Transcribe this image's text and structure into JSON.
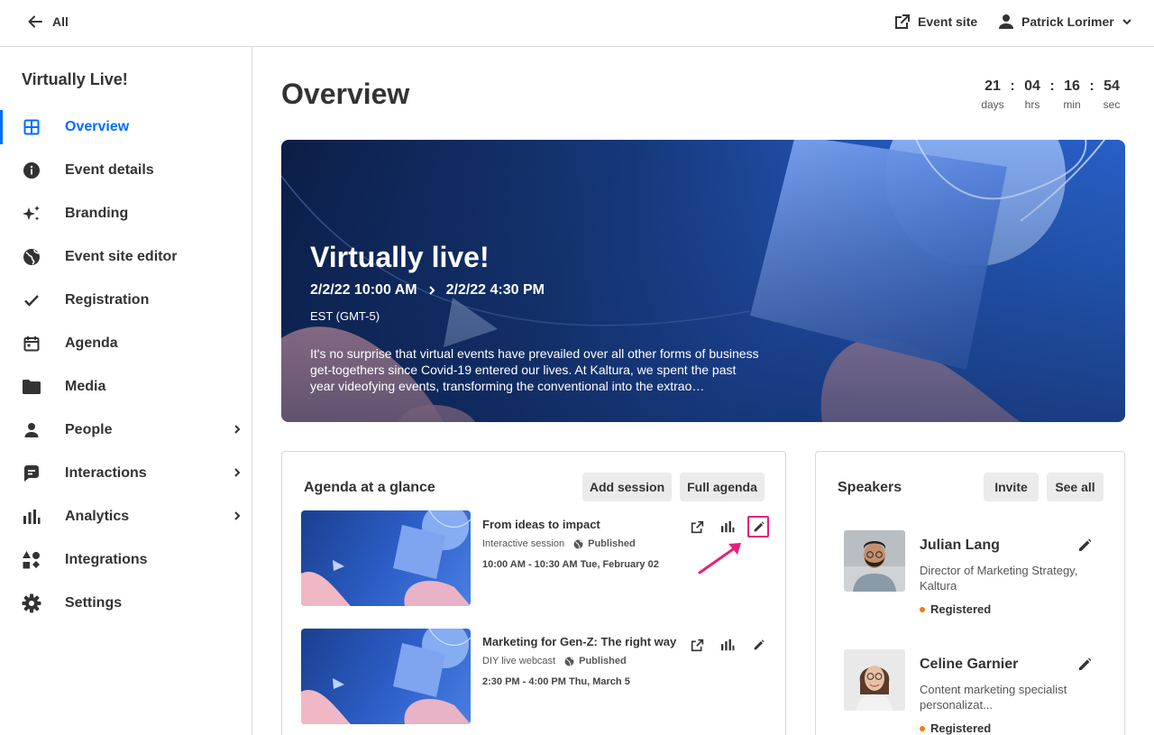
{
  "topbar": {
    "back_label": "All",
    "event_site_label": "Event site",
    "user_name": "Patrick Lorimer"
  },
  "sidebar": {
    "event_name": "Virtually Live!",
    "items": [
      {
        "label": "Overview",
        "icon": "grid-icon",
        "active": true
      },
      {
        "label": "Event details",
        "icon": "info-icon"
      },
      {
        "label": "Branding",
        "icon": "sparkle-icon"
      },
      {
        "label": "Event site editor",
        "icon": "globe-icon"
      },
      {
        "label": "Registration",
        "icon": "check-icon"
      },
      {
        "label": "Agenda",
        "icon": "calendar-icon"
      },
      {
        "label": "Media",
        "icon": "folder-icon"
      },
      {
        "label": "People",
        "icon": "person-icon",
        "expandable": true
      },
      {
        "label": "Interactions",
        "icon": "chat-icon",
        "expandable": true
      },
      {
        "label": "Analytics",
        "icon": "bar-chart-icon",
        "expandable": true
      },
      {
        "label": "Integrations",
        "icon": "shapes-icon"
      },
      {
        "label": "Settings",
        "icon": "gear-icon"
      }
    ]
  },
  "main": {
    "title": "Overview",
    "countdown": {
      "days": "21",
      "days_label": "days",
      "hrs": "04",
      "hrs_label": "hrs",
      "min": "16",
      "min_label": "min",
      "sec": "54",
      "sec_label": "sec",
      "separator": ":"
    },
    "hero": {
      "title": "Virtually live!",
      "start": "2/2/22 10:00 AM",
      "end": "2/2/22 4:30 PM",
      "timezone": "EST (GMT-5)",
      "description": "It's no surprise that virtual events have prevailed over all other forms of business get-togethers since Covid-19 entered our lives. At Kaltura, we spent the past year videofying events, transforming the conventional into the extrao…"
    },
    "agenda": {
      "title": "Agenda at a glance",
      "add_session_label": "Add session",
      "full_agenda_label": "Full agenda",
      "sessions": [
        {
          "title": "From ideas to impact",
          "type": "Interactive session",
          "status": "Published",
          "time": "10:00 AM - 10:30 AM  Tue, February 02"
        },
        {
          "title": "Marketing for Gen-Z: The right way",
          "type": "DIY live webcast",
          "status": "Published",
          "time": "2:30 PM - 4:00 PM Thu, March 5"
        }
      ]
    },
    "speakers": {
      "title": "Speakers",
      "invite_label": "Invite",
      "see_all_label": "See all",
      "list": [
        {
          "name": "Julian Lang",
          "role": "Director of Marketing Strategy, Kaltura",
          "status": "Registered"
        },
        {
          "name": "Celine Garnier",
          "role": "Content marketing specialist personalizat...",
          "status": "Registered"
        }
      ]
    }
  },
  "colors": {
    "accent": "#006efa",
    "highlight": "#e6207a",
    "status_dot": "#f57c00"
  }
}
